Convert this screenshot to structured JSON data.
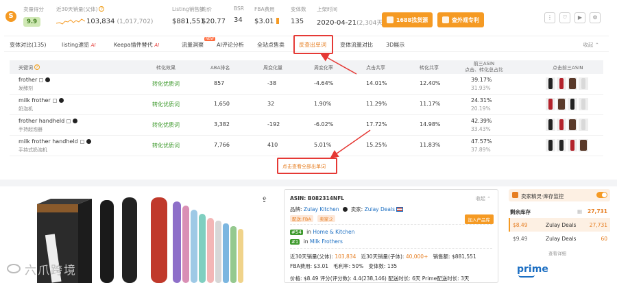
{
  "stats": {
    "score_label": "卖量得分",
    "score_value": "9.9",
    "sales30_label": "近30天销量(父体)",
    "sales30_value": "103,834",
    "sales30_parent": "(1,017,702)",
    "listing_label": "Listing销售额",
    "listing_value": "$881,551",
    "price_label": "均价",
    "price_value": "$20.77",
    "bsr_label": "BSR",
    "bsr_value": "34",
    "fba_label": "FBA费用",
    "fba_value": "$3.01",
    "variants_label": "变体数",
    "variants_value": "135",
    "launch_label": "上架时间",
    "launch_value": "2020-04-21",
    "launch_days": "(2,304天)",
    "btn_1688": "1688找货源",
    "btn_patent": "查外观专利"
  },
  "tabs": [
    {
      "label": "变体对比(135)"
    },
    {
      "label": "listing速览",
      "ai": "AI"
    },
    {
      "label": "Keepa插件替代",
      "ai": "AI"
    },
    {
      "label": "流量洞察",
      "badge": "NEW"
    },
    {
      "label": "AI评论分析"
    },
    {
      "label": "全站点售卖"
    },
    {
      "label": "反查出单词"
    },
    {
      "label": "变体流量对比"
    },
    {
      "label": "3D展示"
    }
  ],
  "tabs_collapse": "收起",
  "kw_table": {
    "headers": [
      "关键词",
      "转化效果",
      "ABA排名",
      "周变化量",
      "周变化率",
      "点击共享",
      "转化共享",
      "前三ASIN\n点击、转化总占比",
      "点击前三ASIN"
    ],
    "header_keyword": "关键词",
    "header_conv": "转化效果",
    "header_aba": "ABA排名",
    "header_wchg": "周变化量",
    "header_wrate": "周变化率",
    "header_click": "点击共享",
    "header_convshare": "转化共享",
    "header_top3_line1": "前三ASIN",
    "header_top3_line2": "点击、转化总占比",
    "header_top3asin": "点击前三ASIN",
    "rows": [
      {
        "en": "frother",
        "cn": "发酵剂",
        "conv": "转化优质词",
        "aba": "857",
        "wchg": "-38",
        "wrate": "-4.64%",
        "click": "14.01%",
        "convshare": "12.40%",
        "top_click": "39.17%",
        "top_conv": "31.93%"
      },
      {
        "en": "milk frother",
        "cn": "奶泡机",
        "conv": "转化优质词",
        "aba": "1,650",
        "wchg": "32",
        "wrate": "1.90%",
        "click": "11.29%",
        "convshare": "11.17%",
        "top_click": "24.31%",
        "top_conv": "20.19%"
      },
      {
        "en": "frother handheld",
        "cn": "手持起泡器",
        "conv": "转化优质词",
        "aba": "3,382",
        "wchg": "-192",
        "wrate": "-6.02%",
        "click": "17.72%",
        "convshare": "14.98%",
        "top_click": "42.39%",
        "top_conv": "33.43%"
      },
      {
        "en": "milk frother handheld",
        "cn": "手持式奶泡机",
        "conv": "转化优质词",
        "aba": "7,766",
        "wchg": "410",
        "wrate": "5.01%",
        "click": "15.25%",
        "convshare": "11.83%",
        "top_click": "47.57%",
        "top_conv": "37.89%"
      }
    ],
    "see_all": "点击查看全部出单词"
  },
  "asin_panel": {
    "asin": "ASIN: B082314NFL",
    "collapse": "收起",
    "brand_label": "品牌:",
    "brand": "Zulay Kitchen",
    "seller_label": "卖家:",
    "seller": "Zulay Deals",
    "tag_fba": "配送:FBA",
    "tag_sellers": "卖家:2",
    "add_product": "加入产品库",
    "rank1_num": "#54",
    "rank1_in": "in",
    "rank1_cat": "Home & Kitchen",
    "rank2_num": "#1",
    "rank2_in": "in",
    "rank2_cat": "Milk Frothers",
    "sales_parent_label": "近30天销量(父体):",
    "sales_parent": "103,834",
    "sales_child_label": "近30天销量(子体):",
    "sales_child": "40,000+",
    "revenue_label": "销售额:",
    "revenue": "$881,551",
    "fba_label": "FBA费用:",
    "fba": "$3.01",
    "margin_label": "毛利率:",
    "margin": "50%",
    "variants_label": "变体数:",
    "variants": "135",
    "price_line": "价格: $8.49   评分(评分数): 4.4(238,146)   配送时长: 6天   Prime配送时长: 3天"
  },
  "seller_panel": {
    "title": "卖家精灵·库存监控",
    "stock_label": "剩余库存",
    "stock_total": "27,731",
    "rows": [
      {
        "price": "$8.49",
        "seller": "Zulay Deals",
        "qty": "27,731"
      },
      {
        "price": "$9.49",
        "seller": "Zulay Deals",
        "qty": "60"
      }
    ],
    "more": "查看详细",
    "prime": "prime"
  },
  "watermark": "六爪跨境"
}
